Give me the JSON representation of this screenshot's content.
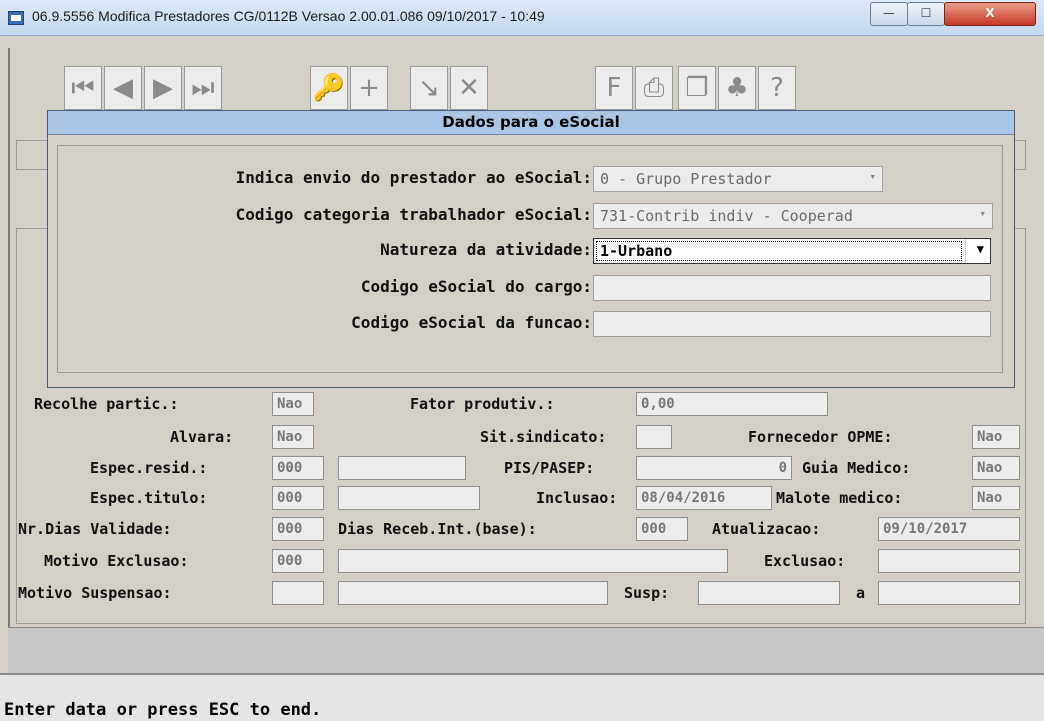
{
  "window": {
    "title": "06.9.5556  Modifica  Prestadores CG/0112B Versao 2.00.01.086 09/10/2017 - 10:49",
    "minimize_glyph": "—",
    "maximize_glyph": "☐",
    "close_glyph": "X"
  },
  "toolbar": {
    "buttons": [
      {
        "icon": "first-record-icon",
        "glyph": "⏮"
      },
      {
        "icon": "previous-record-icon",
        "glyph": "◀"
      },
      {
        "icon": "next-record-icon",
        "glyph": "▶"
      },
      {
        "icon": "last-record-icon",
        "glyph": "⏭"
      },
      {
        "icon": "key-icon",
        "glyph": "🔑"
      },
      {
        "icon": "add-icon",
        "glyph": "+"
      },
      {
        "icon": "edit-icon",
        "glyph": "↘"
      },
      {
        "icon": "delete-icon",
        "glyph": "✕"
      },
      {
        "icon": "filter-icon",
        "glyph": "F"
      },
      {
        "icon": "print-icon",
        "glyph": "⎙"
      },
      {
        "icon": "copy-icon",
        "glyph": "❐"
      },
      {
        "icon": "exit-icon",
        "glyph": "♣"
      },
      {
        "icon": "help-icon",
        "glyph": "?"
      }
    ]
  },
  "background_form": {
    "recolhe_partic_label": "Recolhe partic.:",
    "recolhe_partic_value": "Nao",
    "fator_produtiv_label": "Fator produtiv.:",
    "fator_produtiv_value": "0,00",
    "alvara_label": "Alvara:",
    "alvara_value": "Nao",
    "sit_sindicato_label": "Sit.sindicato:",
    "sit_sindicato_value": "",
    "fornecedor_opme_label": "Fornecedor OPME:",
    "fornecedor_opme_value": "Nao",
    "espec_resid_label": "Espec.resid.:",
    "espec_resid_value": "000",
    "pis_pasep_label": "PIS/PASEP:",
    "pis_pasep_value": "0",
    "guia_medico_label": "Guia Medico:",
    "guia_medico_value": "Nao",
    "espec_titulo_label": "Espec.titulo:",
    "espec_titulo_value": "000",
    "inclusao_label": "Inclusao:",
    "inclusao_value": "08/04/2016",
    "malote_medico_label": "Malote medico:",
    "malote_medico_value": "Nao",
    "nr_dias_validade_label": "Nr.Dias Validade:",
    "nr_dias_validade_value": "000",
    "dias_receb_label": "Dias Receb.Int.(base):",
    "dias_receb_value": "000",
    "atualizacao_label": "Atualizacao:",
    "atualizacao_value": "09/10/2017",
    "motivo_exclusao_label": "Motivo Exclusao:",
    "motivo_exclusao_value": "000",
    "exclusao_label": "Exclusao:",
    "motivo_suspensao_label": "Motivo Suspensao:",
    "susp_label": "Susp:",
    "a_label": "a"
  },
  "dialog": {
    "title": "Dados para o eSocial",
    "indica_envio_label": "Indica envio do prestador ao eSocial:",
    "indica_envio_value": "0 - Grupo Prestador",
    "codigo_categoria_label": "Codigo categoria trabalhador eSocial:",
    "codigo_categoria_value": "731-Contrib indiv - Cooperad",
    "natureza_label": "Natureza da atividade:",
    "natureza_value": "1-Urbano",
    "codigo_cargo_label": "Codigo eSocial do cargo:",
    "codigo_cargo_value": "",
    "codigo_funcao_label": "Codigo eSocial da funcao:",
    "codigo_funcao_value": "",
    "arrow_glyph": "▾",
    "arrow_glyph_active": "▼"
  },
  "status": {
    "message": "Enter data or press ESC to end."
  }
}
